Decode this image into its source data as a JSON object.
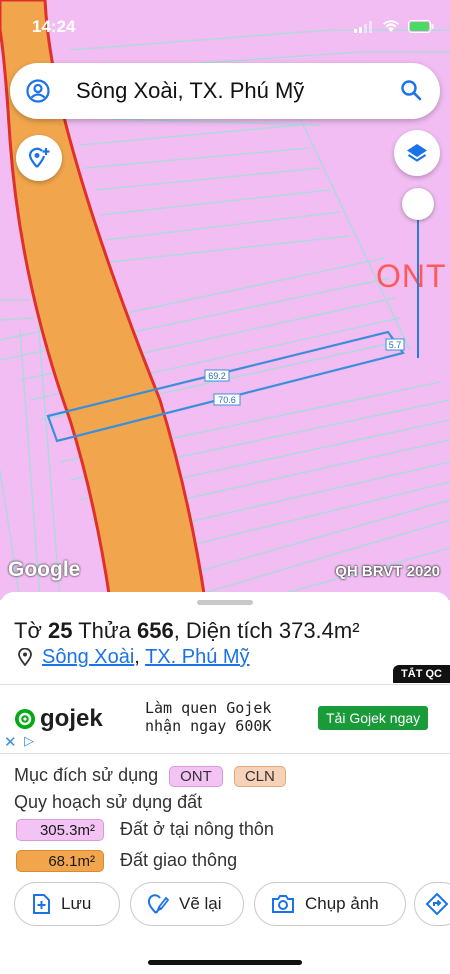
{
  "status_bar": {
    "time": "14:24"
  },
  "search": {
    "text": "Sông Xoài, TX. Phú Mỹ"
  },
  "map": {
    "zone_label": "ONT",
    "measure_top": "69.2",
    "measure_bottom": "70.6",
    "measure_side": "5.7",
    "google_label": "Google",
    "source_label": "QH BRVT 2020"
  },
  "parcel": {
    "prefix_to": "Tờ",
    "to_number": "25",
    "prefix_thua": "Thửa",
    "thua_number": "656",
    "area_text": ", Diện tích 373.4m²",
    "location_part1": "Sông Xoài",
    "location_sep": ",",
    "location_part2": "TX. Phú Mỹ"
  },
  "ad": {
    "close_tag": "TẮT QC",
    "brand": "gojek",
    "line1": "Làm quen Gojek",
    "line2": "nhận ngay 600K",
    "cta": "Tải Gojek ngay",
    "close": "✕",
    "adchoices": "▷"
  },
  "land_use": {
    "label": "Mục đích sử dụng",
    "codes": [
      "ONT",
      "CLN"
    ],
    "planning_label": "Quy hoạch sử dụng đất",
    "items": [
      {
        "area": "305.3m²",
        "desc": "Đất ở tại nông thôn",
        "color": "#f3c4f3"
      },
      {
        "area": "68.1m²",
        "desc": "Đất giao thông",
        "color": "#f1a64d"
      }
    ]
  },
  "actions": {
    "save": "Lưu",
    "redraw": "Vẽ lại",
    "capture": "Chụp ảnh"
  },
  "colors": {
    "map_bg": "#f1bdf2",
    "road_fill": "#f1a64d",
    "road_border": "#e0302a",
    "accent": "#1a73e8",
    "parcel_line": "#3b8fd8"
  }
}
